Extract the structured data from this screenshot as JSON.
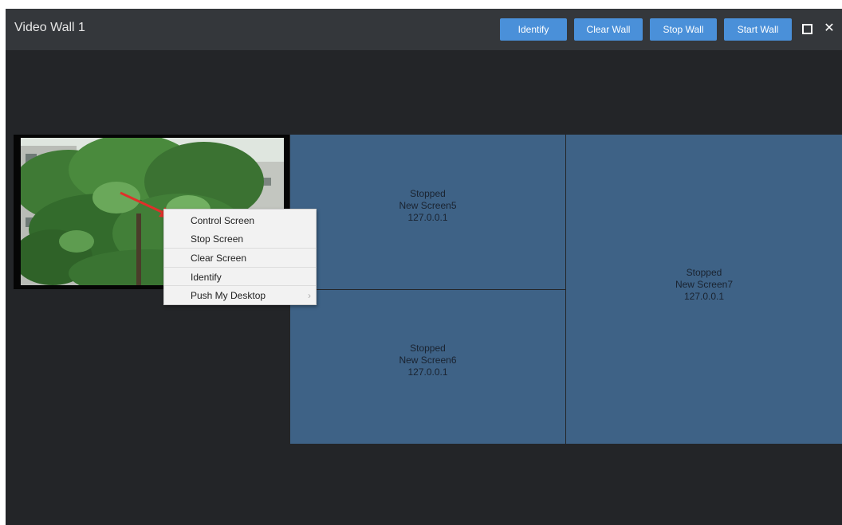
{
  "window": {
    "title": "Video Wall 1"
  },
  "toolbar": {
    "identify_label": "Identify",
    "clear_wall_label": "Clear Wall",
    "stop_wall_label": "Stop Wall",
    "start_wall_label": "Start Wall",
    "maximize_icon": "maximize-icon",
    "close_icon": "close-icon"
  },
  "screens": [
    {
      "status": "Stopped",
      "name": "New Screen5",
      "ip": "127.0.0.1"
    },
    {
      "status": "Stopped",
      "name": "New Screen6",
      "ip": "127.0.0.1"
    },
    {
      "status": "Stopped",
      "name": "New Screen7",
      "ip": "127.0.0.1"
    }
  ],
  "context_menu": {
    "items": [
      {
        "label": "Control Screen"
      },
      {
        "label": "Stop Screen"
      },
      {
        "label": "Clear Screen"
      },
      {
        "label": "Identify"
      },
      {
        "label": "Push My Desktop",
        "submenu_icon": "chevron-right-icon"
      }
    ]
  },
  "colors": {
    "window_bg": "#232528",
    "titlebar_bg": "#34373b",
    "button_accent": "#4a90d9",
    "screen_tile": "#3e6286",
    "annotation_arrow": "#e0302a"
  }
}
